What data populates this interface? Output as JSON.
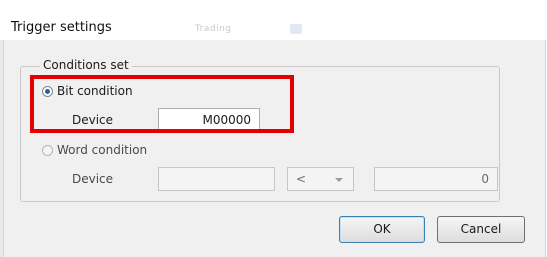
{
  "window": {
    "title": "Trigger settings",
    "background_hint_text": "Trading"
  },
  "conditions": {
    "group_label": "Conditions set",
    "bit": {
      "label": "Bit condition",
      "selected": true,
      "device_label": "Device",
      "device_value": "M00000"
    },
    "word": {
      "label": "Word condition",
      "selected": false,
      "device_label": "Device",
      "device_value": "",
      "operator": "<",
      "compare_value": "0"
    }
  },
  "buttons": {
    "ok": "OK",
    "cancel": "Cancel"
  },
  "colors": {
    "highlight": "#e40000",
    "radio_dot": "#2b5fa8",
    "dialog_bg": "#f0f0f0"
  }
}
